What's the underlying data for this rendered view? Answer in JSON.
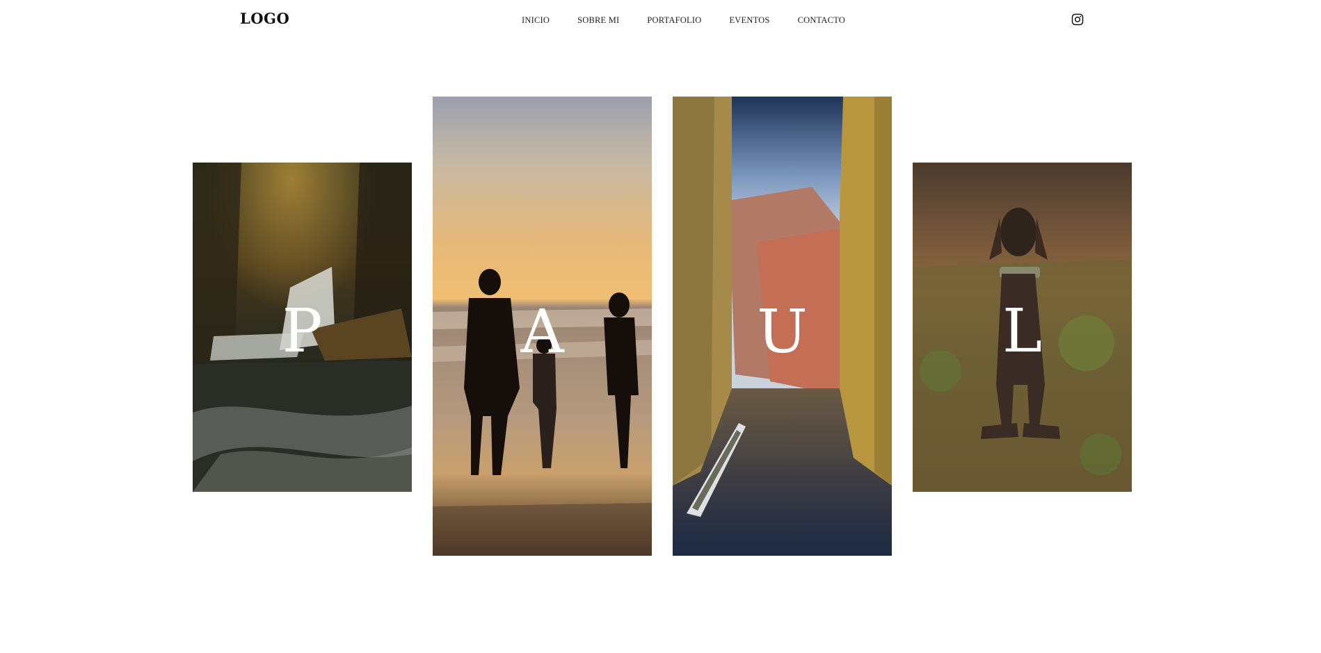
{
  "header": {
    "logo": "LOGO",
    "nav": [
      "INICIO",
      "SOBRE MI",
      "PORTAFOLIO",
      "EVENTOS",
      "CONTACTO"
    ],
    "social_icon": "instagram-icon"
  },
  "gallery": {
    "letters": [
      "P",
      "A",
      "U",
      "L"
    ],
    "photos": [
      "waterfall-photo",
      "family-beach-photo",
      "venice-canal-photo",
      "dog-photo"
    ]
  }
}
